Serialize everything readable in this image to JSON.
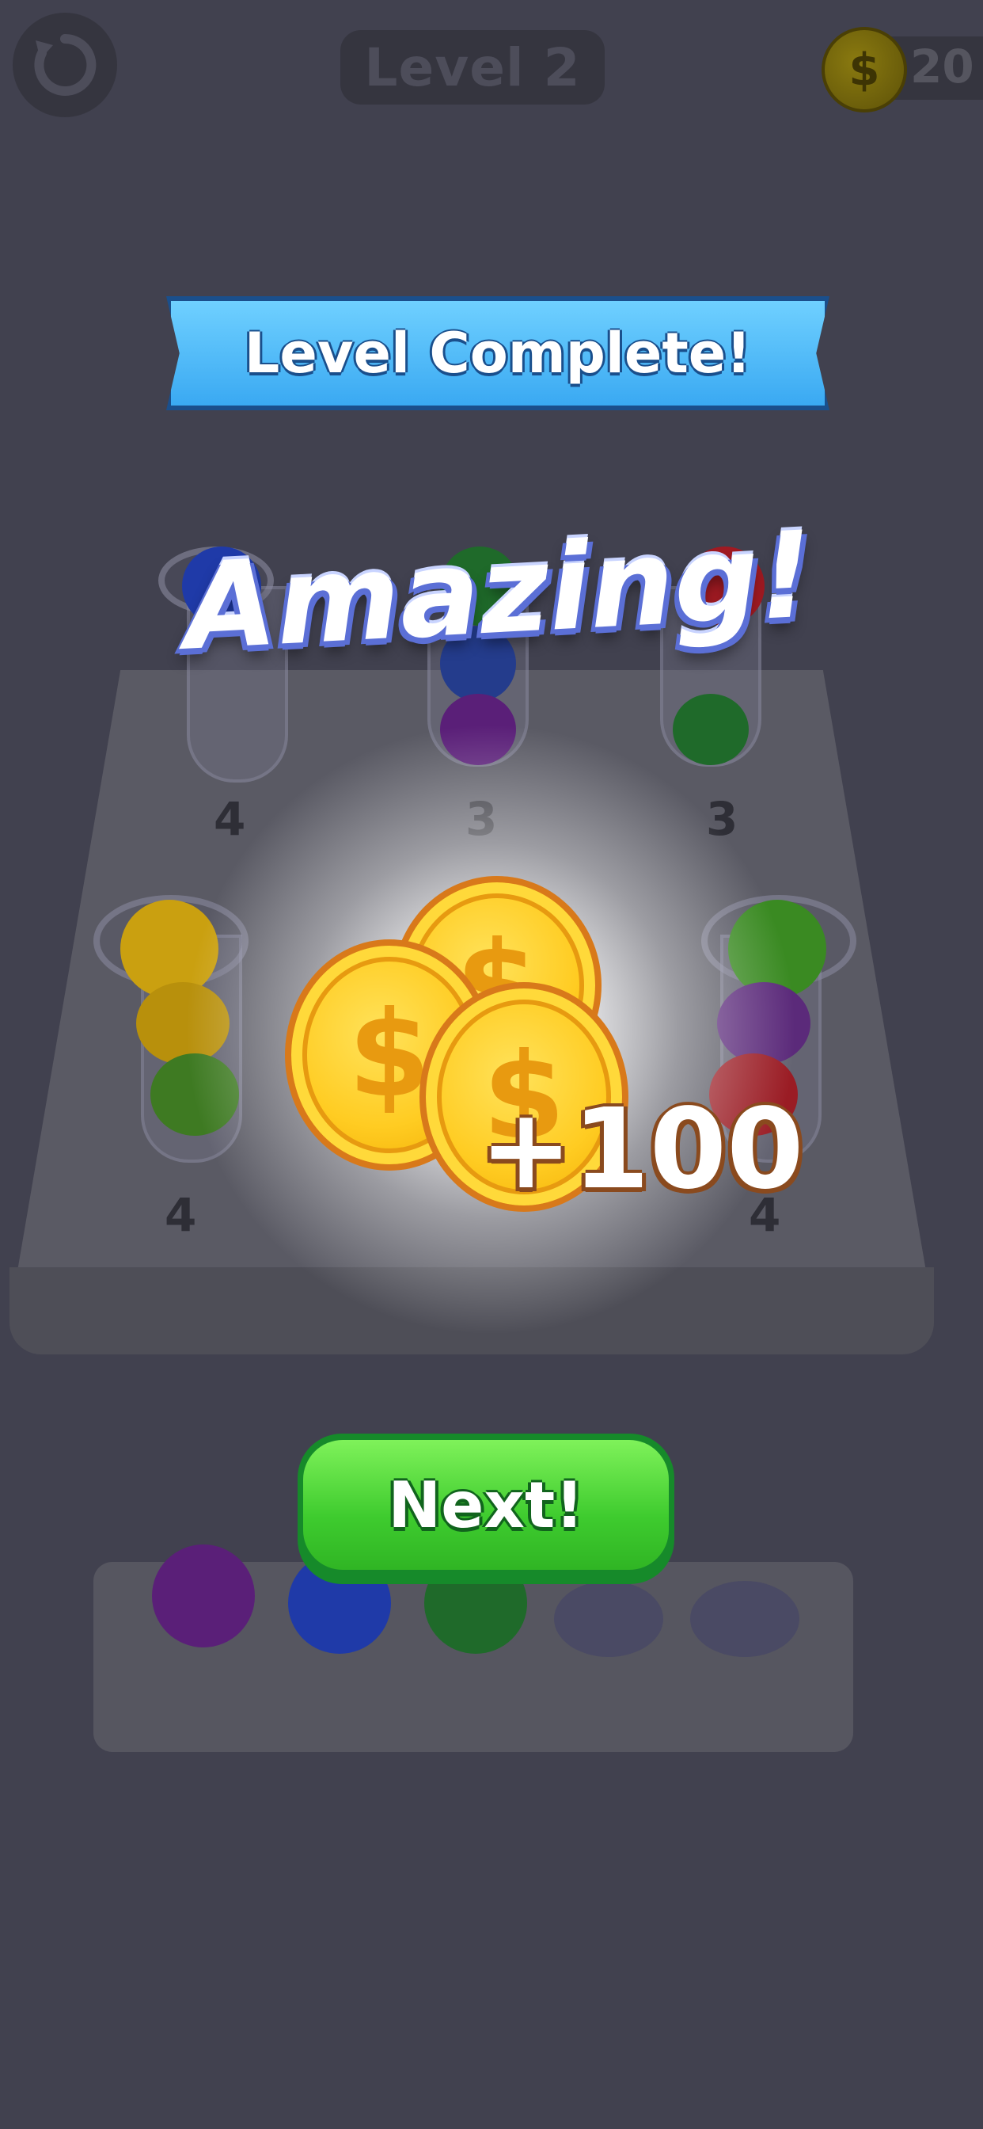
{
  "hud": {
    "level_label": "Level 2",
    "coin_count": "20",
    "coin_symbol": "$"
  },
  "board": {
    "tubes": [
      {
        "count_label": "4",
        "balls": [
          "#1f3aa8"
        ]
      },
      {
        "count_label": "3",
        "balls": [
          "#1f6a2a",
          "#243c8c",
          "#5a1f78"
        ]
      },
      {
        "count_label": "3",
        "balls": [
          "#a01a22",
          "#1f6a2a"
        ]
      },
      {
        "count_label": "4",
        "balls": [
          "#caa010",
          "#b8900c",
          "#3e7a22"
        ]
      },
      {
        "count_label": "4",
        "balls": [
          "#3a8a22",
          "#5b2a7a",
          "#9a1c24"
        ]
      }
    ],
    "tray_balls": [
      "#5a1f78",
      "#1f3aa8",
      "#1f6a2a"
    ]
  },
  "popup": {
    "banner_title": "Level Complete!",
    "praise": "Amazing!",
    "coin_symbol": "$",
    "reward_text": "+100",
    "next_label": "Next!"
  },
  "colors": {
    "banner": "#3aa9f2",
    "next_button": "#3ecb2e",
    "coin": "#ffcc22"
  }
}
